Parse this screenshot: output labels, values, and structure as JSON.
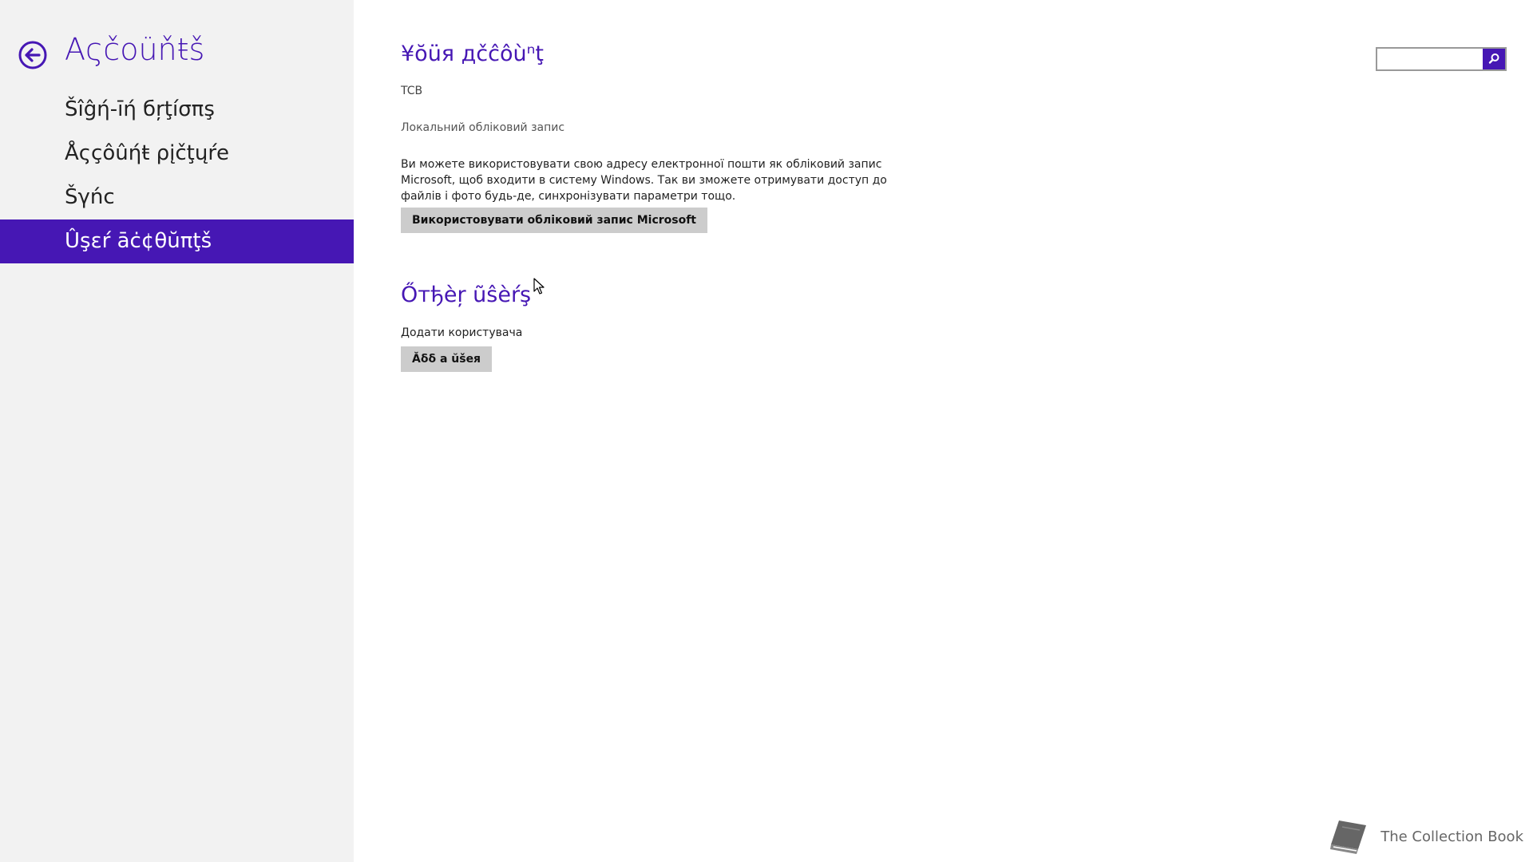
{
  "sidebar": {
    "title": "Aςčoüňŧš",
    "items": [
      {
        "label": "Šîĝή-īή бŗţíσπş"
      },
      {
        "label": "Åςçôûήŧ ρįčţųŕе"
      },
      {
        "label": "Šγńс"
      },
      {
        "label": "Ûşεŕ āċ¢θŭπţš"
      }
    ],
    "selected_index": 3
  },
  "your_account": {
    "title": "¥ŏüя дčĉôùⁿţ",
    "name": "TCB",
    "type": "Локальний обліковий запис",
    "description": "Ви можете використовувати свою адресу електронної пошти як обліковий запис Microsoft, щоб входити в систему Windows. Так ви зможете отримувати доступ до файлів і фото будь-де, синхронізувати параметри тощо.",
    "button_label": "Використовувати обліковий запис Microsoft"
  },
  "other_users": {
    "title": "Őтђèŗ ũŝèŕş",
    "add_label": "Додати користувача",
    "add_button_label": "Ăδδ а ŭšея"
  },
  "search": {
    "value": "",
    "placeholder": ""
  },
  "icons": {
    "back": "back-arrow-circle-icon",
    "search": "search-icon",
    "book": "book-icon",
    "cursor": "mouse-pointer-icon"
  },
  "colors": {
    "accent": "#4617b4",
    "sidebar_bg": "#f2f2f2",
    "button_bg": "#cccccc"
  },
  "watermark": {
    "text": "The Collection Book"
  }
}
